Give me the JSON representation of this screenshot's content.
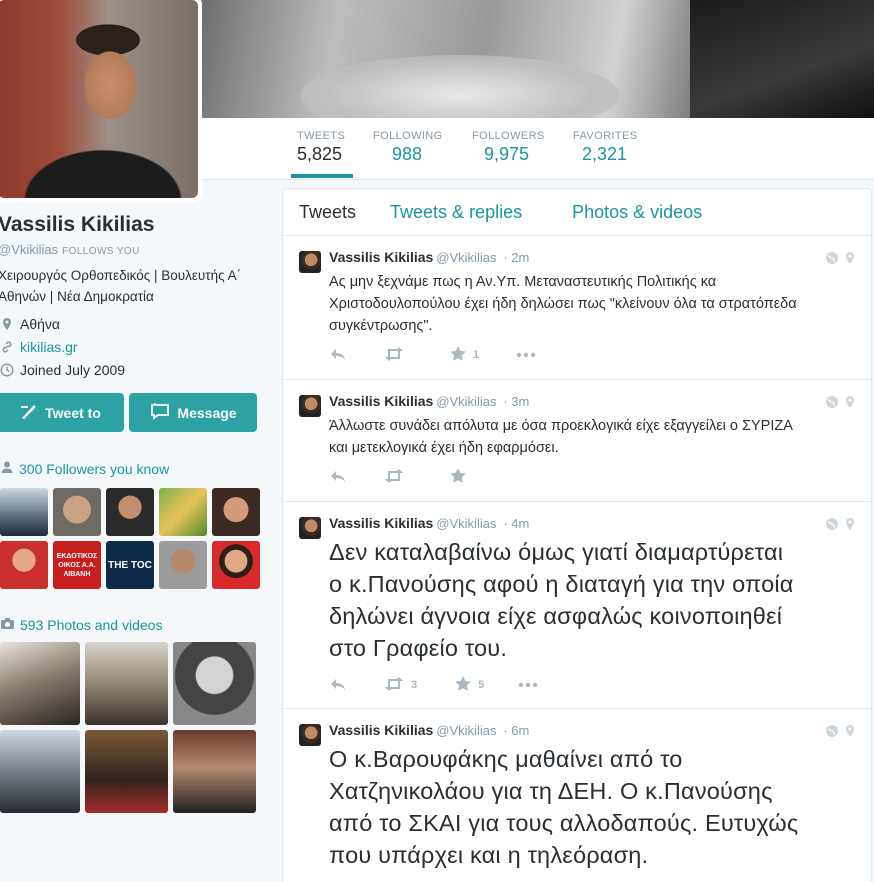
{
  "profile": {
    "name": "Vassilis Kikilias",
    "handle": "@Vkikilias",
    "follows_you": "FOLLOWS YOU",
    "bio_line1": "Χειρουργός Ορθοπεδικός | Βουλευτής Α΄",
    "bio_line2": "Αθηνών | Νέα Δημοκρατία",
    "location": "Αθήνα",
    "website": "kikilias.gr",
    "joined": "Joined July 2009"
  },
  "buttons": {
    "tweet_to": "Tweet to",
    "message": "Message"
  },
  "followers_you_know": "300 Followers you know",
  "photos_videos": "593 Photos and videos",
  "follower_thumbs": [
    {
      "caption": ""
    },
    {
      "caption": ""
    },
    {
      "caption": ""
    },
    {
      "caption": ""
    },
    {
      "caption": ""
    },
    {
      "caption": "ΕΚΔΟΤΙΚΟΣ ΟΙΚΟΣ Α.Α. ΛΙΒΑΝΗ"
    },
    {
      "caption": ""
    },
    {
      "caption": "THE TOC"
    },
    {
      "caption": ""
    },
    {
      "caption": ""
    }
  ],
  "stats": [
    {
      "label": "TWEETS",
      "value": "5,825"
    },
    {
      "label": "FOLLOWING",
      "value": "988"
    },
    {
      "label": "FOLLOWERS",
      "value": "9,975"
    },
    {
      "label": "FAVORITES",
      "value": "2,321"
    }
  ],
  "tabs": [
    "Tweets",
    "Tweets & replies",
    "Photos & videos"
  ],
  "tweets": [
    {
      "name": "Vassilis Kikilias",
      "handle": "@Vkikilias",
      "time": "· 2m",
      "lines": [
        "Ας μην ξεχνάμε πως η Αν.Υπ. Μεταναστευτικής Πολιτικής κα",
        "Χριστοδουλοπούλου έχει ήδη δηλώσει πως \"κλείνουν όλα τα στρατόπεδα",
        "συγκέντρωσης\"."
      ],
      "retweets": "",
      "favorites": "1"
    },
    {
      "name": "Vassilis Kikilias",
      "handle": "@Vkikilias",
      "time": "· 3m",
      "lines": [
        "Άλλωστε συνάδει απόλυτα με όσα προεκλογικά είχε εξαγγείλει ο ΣΥΡΙΖΑ",
        "και μετεκλογικά έχει ήδη εφαρμόσει."
      ],
      "retweets": "",
      "favorites": ""
    },
    {
      "name": "Vassilis Kikilias",
      "handle": "@Vkikilias",
      "time": "· 4m",
      "lines": [
        "Δεν καταλαβαίνω όμως γιατί διαμαρτύρεται",
        "ο κ.Πανούσης αφού η διαταγή για την οποία",
        "δηλώνει άγνοια είχε ασφαλώς κοινοποιηθεί",
        "στο Γραφείο του."
      ],
      "retweets": "3",
      "favorites": "5"
    },
    {
      "name": "Vassilis Kikilias",
      "handle": "@Vkikilias",
      "time": "· 6m",
      "lines": [
        "Ο κ.Βαρουφάκης μαθαίνει από το",
        "Χατζηνικολάου για τη ΔΕΗ. Ο κ.Πανούσης",
        "από το ΣΚΑΙ για τους αλλοδαπούς. Ευτυχώς",
        "που υπάρχει και η τηλεόραση."
      ],
      "retweets": "",
      "favorites": ""
    }
  ],
  "colors": {
    "accent": "#1b95a0",
    "button": "#2ca2a4",
    "muted": "#8899a6"
  }
}
